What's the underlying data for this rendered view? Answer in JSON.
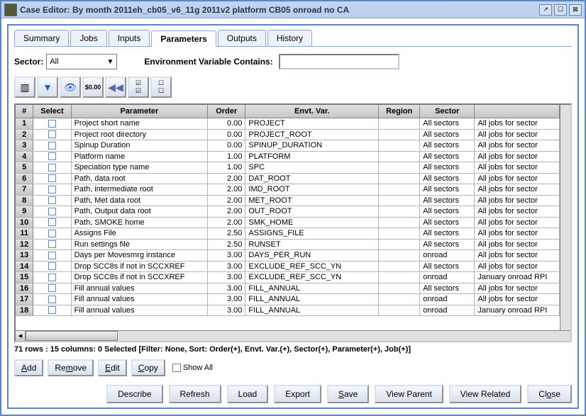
{
  "window": {
    "title": "Case Editor: By month 2011eh_cb05_v6_11g 2011v2 platform CB05 onroad no CA"
  },
  "tabs": [
    "Summary",
    "Jobs",
    "Inputs",
    "Parameters",
    "Outputs",
    "History"
  ],
  "active_tab": "Parameters",
  "filter": {
    "sector_label": "Sector:",
    "sector_value": "All",
    "env_label": "Environment Variable Contains:",
    "env_value": ""
  },
  "toolbar_icons": [
    "columns",
    "funnel",
    "eye",
    "currency",
    "rewind",
    "check1",
    "check2"
  ],
  "columns": [
    "#",
    "Select",
    "Parameter",
    "Order",
    "Envt. Var.",
    "Region",
    "Sector",
    ""
  ],
  "rows": [
    {
      "n": 1,
      "param": "Project short name",
      "order": "0.00",
      "env": "PROJECT",
      "region": "",
      "sector": "All sectors",
      "job": "All jobs for sector"
    },
    {
      "n": 2,
      "param": "Project root directory",
      "order": "0.00",
      "env": "PROJECT_ROOT",
      "region": "",
      "sector": "All sectors",
      "job": "All jobs for sector"
    },
    {
      "n": 3,
      "param": "Spinup Duration",
      "order": "0.00",
      "env": "SPINUP_DURATION",
      "region": "",
      "sector": "All sectors",
      "job": "All jobs for sector"
    },
    {
      "n": 4,
      "param": "Platform name",
      "order": "1.00",
      "env": "PLATFORM",
      "region": "",
      "sector": "All sectors",
      "job": "All jobs for sector"
    },
    {
      "n": 5,
      "param": "Speciation type name",
      "order": "1.00",
      "env": "SPC",
      "region": "",
      "sector": "All sectors",
      "job": "All jobs for sector"
    },
    {
      "n": 6,
      "param": "Path, data root",
      "order": "2.00",
      "env": "DAT_ROOT",
      "region": "",
      "sector": "All sectors",
      "job": "All jobs for sector"
    },
    {
      "n": 7,
      "param": "Path, intermediate root",
      "order": "2.00",
      "env": "IMD_ROOT",
      "region": "",
      "sector": "All sectors",
      "job": "All jobs for sector"
    },
    {
      "n": 8,
      "param": "Path, Met data root",
      "order": "2.00",
      "env": "MET_ROOT",
      "region": "",
      "sector": "All sectors",
      "job": "All jobs for sector"
    },
    {
      "n": 9,
      "param": "Path, Output data root",
      "order": "2.00",
      "env": "OUT_ROOT",
      "region": "",
      "sector": "All sectors",
      "job": "All jobs for sector"
    },
    {
      "n": 10,
      "param": "Path, SMOKE home",
      "order": "2.00",
      "env": "SMK_HOME",
      "region": "",
      "sector": "All sectors",
      "job": "All jobs for sector"
    },
    {
      "n": 11,
      "param": "Assigns File",
      "order": "2.50",
      "env": "ASSIGNS_FILE",
      "region": "",
      "sector": "All sectors",
      "job": "All jobs for sector"
    },
    {
      "n": 12,
      "param": "Run settings file",
      "order": "2.50",
      "env": "RUNSET",
      "region": "",
      "sector": "All sectors",
      "job": "All jobs for sector"
    },
    {
      "n": 13,
      "param": "Days per Movesmrg instance",
      "order": "3.00",
      "env": "DAYS_PER_RUN",
      "region": "",
      "sector": "onroad",
      "job": "All jobs for sector"
    },
    {
      "n": 14,
      "param": "Drop SCC8s if not in SCCXREF",
      "order": "3.00",
      "env": "EXCLUDE_REF_SCC_YN",
      "region": "",
      "sector": "All sectors",
      "job": "All jobs for sector"
    },
    {
      "n": 15,
      "param": "Drop SCC8s if not in SCCXREF",
      "order": "3.00",
      "env": "EXCLUDE_REF_SCC_YN",
      "region": "",
      "sector": "onroad",
      "job": "January onroad RPI"
    },
    {
      "n": 16,
      "param": "Fill annual values",
      "order": "3.00",
      "env": "FILL_ANNUAL",
      "region": "",
      "sector": "All sectors",
      "job": "All jobs for sector"
    },
    {
      "n": 17,
      "param": "Fill annual values",
      "order": "3.00",
      "env": "FILL_ANNUAL",
      "region": "",
      "sector": "onroad",
      "job": "All jobs for sector"
    },
    {
      "n": 18,
      "param": "Fill annual values",
      "order": "3.00",
      "env": "FILL_ANNUAL",
      "region": "",
      "sector": "onroad",
      "job": "January onroad RPI"
    }
  ],
  "status": "71 rows : 15 columns: 0 Selected [Filter: None, Sort: Order(+), Envt. Var.(+), Sector(+), Parameter(+), Job(+)]",
  "actions": {
    "add": "Add",
    "remove": "Remove",
    "edit": "Edit",
    "copy": "Copy",
    "showall": "Show All"
  },
  "footer": {
    "describe": "Describe",
    "refresh": "Refresh",
    "load": "Load",
    "export": "Export",
    "save": "Save",
    "viewparent": "View Parent",
    "viewrelated": "View Related",
    "close": "Close"
  }
}
